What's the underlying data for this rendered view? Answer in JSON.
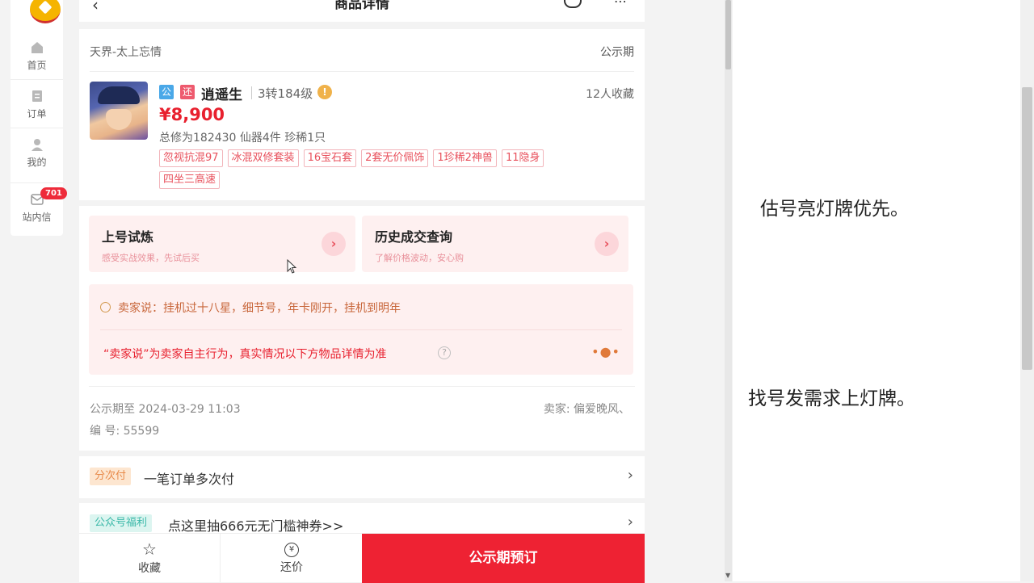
{
  "nav": {
    "items": [
      {
        "label": "首页",
        "icon": "home-icon"
      },
      {
        "label": "订单",
        "icon": "order-icon"
      },
      {
        "label": "我的",
        "icon": "user-icon"
      },
      {
        "label": "站内信",
        "icon": "message-icon"
      }
    ],
    "message_badge": "701"
  },
  "header": {
    "title": "商品详情"
  },
  "product": {
    "server": "天界-太上忘情",
    "status": "公示期",
    "tag1": "公",
    "tag2": "还",
    "name": "逍遥生",
    "level": "3转184级",
    "favorites": "12人收藏",
    "price": "¥8,900",
    "summary": "总修为182430  仙器4件  珍稀1只",
    "chips": [
      "忽视抗混97",
      "冰混双修套装",
      "16宝石套",
      "2套无价佩饰",
      "1珍稀2神兽",
      "11隐身",
      "四坐三高速"
    ]
  },
  "actions": {
    "trial_title": "上号试炼",
    "trial_sub": "感受实战效果，先试后买",
    "history_title": "历史成交查询",
    "history_sub": "了解价格波动，安心购"
  },
  "seller": {
    "says": "卖家说：挂机过十八星，细节号，年卡刚开，挂机到明年",
    "disclaimer": "“卖家说”为卖家自主行为，真实情况以下方物品详情为准",
    "period_until": "公示期至 2024-03-29 11:03",
    "seller_name": "卖家: 偏爱晚风、",
    "serial": "编 号: 55599"
  },
  "rows": {
    "installment_tag": "分次付",
    "installment_text": "一笔订单多次付",
    "wechat_tag": "公众号福利",
    "wechat_text": "点这里抽666元无门槛神券>>"
  },
  "bottom": {
    "favorite": "收藏",
    "bargain": "还价",
    "reserve": "公示期预订"
  },
  "notes": {
    "note1": "估号亮灯牌优先。",
    "note2": "找号发需求上灯牌。"
  },
  "colors": {
    "accent": "#ee2233",
    "price": "#e8202e",
    "pink_bg": "#fef0f0"
  }
}
